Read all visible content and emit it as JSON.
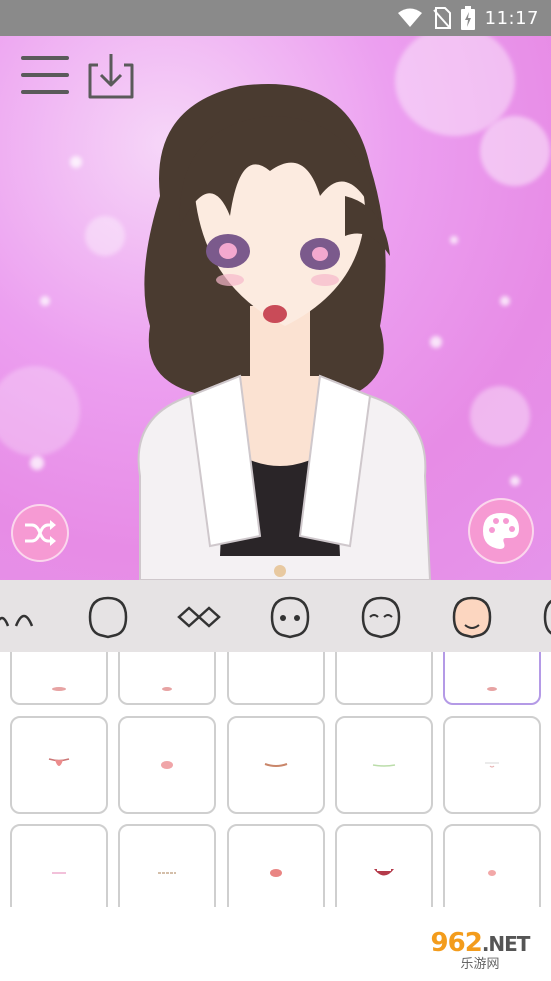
{
  "status_bar": {
    "time": "11:17",
    "icons": [
      "wifi-icon",
      "no-sim-icon",
      "battery-charging-icon"
    ]
  },
  "canvas": {
    "background_color": "#e98fe6",
    "accent_button_color": "#f69ad3"
  },
  "header": {
    "menu_icon": "hamburger-menu-icon",
    "download_icon": "download-icon"
  },
  "actions": {
    "shuffle_icon": "shuffle-icon",
    "palette_icon": "palette-icon"
  },
  "category_tabs": [
    {
      "name": "eyebrows",
      "icon": "eyebrows-icon"
    },
    {
      "name": "face-shape",
      "icon": "face-outline-icon"
    },
    {
      "name": "eyes",
      "icon": "eyes-icon"
    },
    {
      "name": "face-eyes",
      "icon": "face-eyes-icon"
    },
    {
      "name": "face-closed-eyes",
      "icon": "face-closed-eyes-icon"
    },
    {
      "name": "face-mouth",
      "icon": "face-mouth-icon"
    },
    {
      "name": "face-partial",
      "icon": "face-partial-icon"
    }
  ],
  "selected_tab": "face-mouth",
  "mouth_options": {
    "selected_row": 0,
    "selected_col": 4
  },
  "watermark": {
    "main": "962",
    "suffix": ".NET",
    "sub": "乐游网"
  }
}
